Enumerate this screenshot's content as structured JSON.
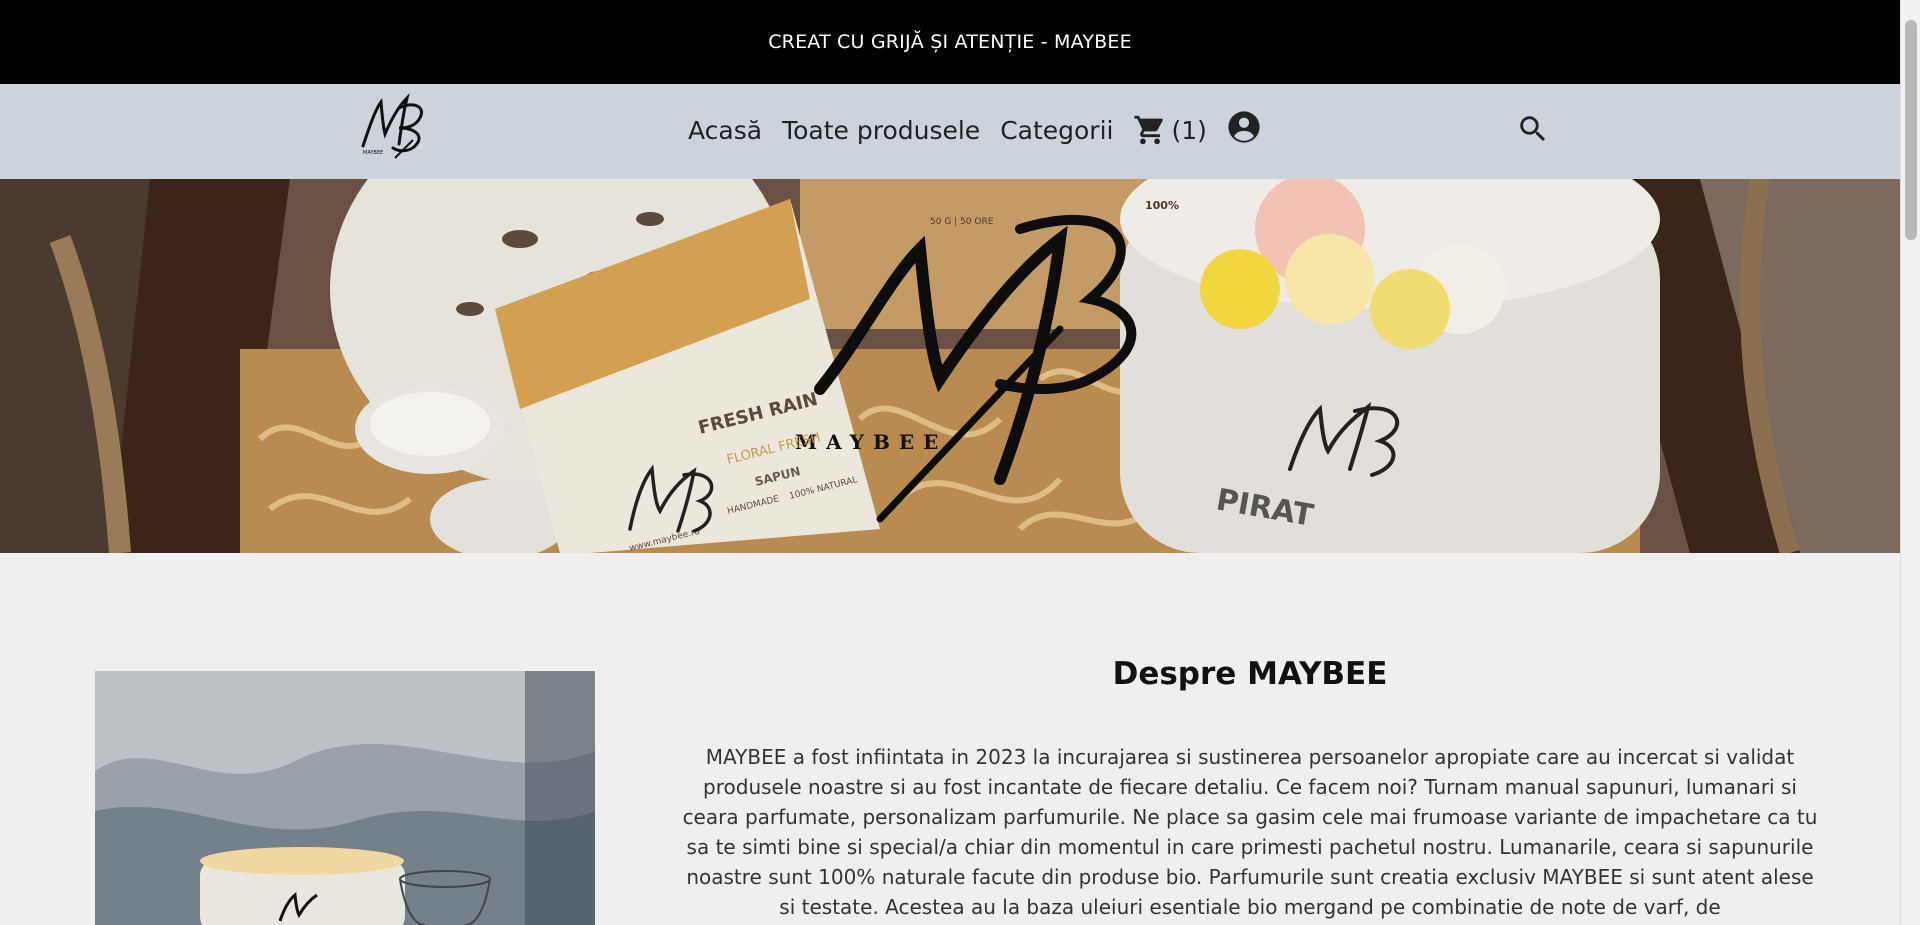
{
  "announcement": "CREAT CU GRIJĂ ȘI ATENȚIE - MAYBEE",
  "nav": {
    "logo_alt": "MAYBEE logo",
    "home": "Acasă",
    "all_products": "Toate produsele",
    "categories": "Categorii",
    "cart_count": "(1)",
    "cart_icon": "shopping-cart-icon",
    "account_icon": "account-circle-icon",
    "search_icon": "search-icon"
  },
  "hero": {
    "brand_mark": "MB",
    "brand_name": "MAYBEE",
    "product_label_1": "FRESH RAIN",
    "product_label_2": "FLORAL FRESH",
    "product_label_3": "SAPUN",
    "product_label_4": "HANDMADE",
    "product_label_5": "100% NATURAL",
    "product_label_6": "www.maybee.ro",
    "product_label_7": "PIRAT",
    "box_label_1": "50 G | 50 ORE",
    "box_label_2": "100%"
  },
  "about": {
    "title": "Despre MAYBEE",
    "text": "MAYBEE a fost infiintata in 2023 la incurajarea si sustinerea persoanelor apropiate care au incercat si validat produsele noastre si au fost incantate de fiecare detaliu. Ce facem noi? Turnam manual sapunuri, lumanari si ceara parfumate, personalizam parfumurile. Ne place sa gasim cele mai frumoase variante de impachetare ca tu sa te simti bine si special/a chiar din momentul in care primesti pachetul nostru. Lumanarile, ceara si sapunurile noastre sunt 100% naturale facute din produse bio. Parfumurile sunt creatia exclusiv MAYBEE si sunt atent alese si testate. Acestea au la baza uleiuri esentiale bio mergand pe combinatie de note de varf, de"
  },
  "colors": {
    "topbar_bg": "#000000",
    "navbar_bg": "#cdd3da",
    "page_bg": "#efefef"
  }
}
